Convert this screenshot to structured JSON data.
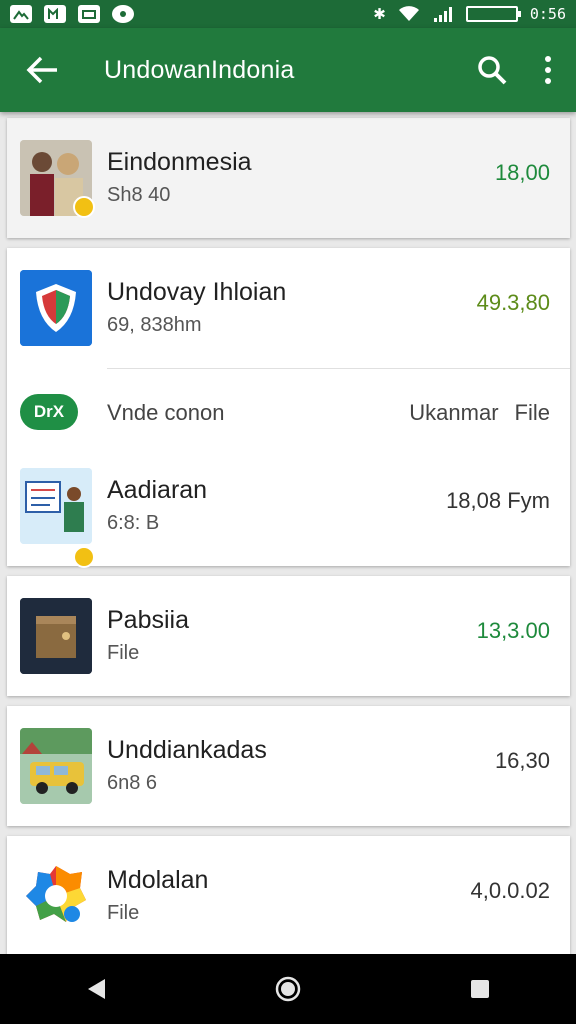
{
  "status_bar": {
    "time": "0:56",
    "left_icons": [
      "image-icon",
      "map-icon",
      "message-icon",
      "camera-icon"
    ],
    "right_icons": [
      "bluetooth-icon",
      "wifi-icon",
      "signal-icon",
      "battery-icon"
    ]
  },
  "app_bar": {
    "title": "UndowanIndonia",
    "back_icon": "arrow-left-icon",
    "search_icon": "search-icon",
    "menu_icon": "more-vert-icon"
  },
  "items": [
    {
      "name": "Eindonmesia",
      "subtitle": "Sh8 40",
      "amount": "18,00",
      "amount_color": "green",
      "thumb": "people-photo"
    },
    {
      "name": "Undovay Ihloian",
      "subtitle": "69, 838hm",
      "amount": "49.3,80",
      "amount_color": "olive",
      "thumb": "shield-app"
    },
    {
      "name": "Aadiaran",
      "subtitle": "6:8: B",
      "amount": "18,08 Fym",
      "amount_color": "default",
      "thumb": "presentation"
    },
    {
      "name": "Pabsiia",
      "subtitle": "File",
      "amount": "13,3.00",
      "amount_color": "green",
      "thumb": "box"
    },
    {
      "name": "Unddiankadas",
      "subtitle": "6n8 6",
      "amount": "16,30",
      "amount_color": "default",
      "thumb": "car-photo"
    },
    {
      "name": "Mdolalan",
      "subtitle": "File",
      "amount": "4,0.0.02",
      "amount_color": "default",
      "thumb": "colorful-logo"
    }
  ],
  "tag_row": {
    "tag": "DrX",
    "label": "Vnde conon",
    "right_label": "Ukanmar",
    "right_file": "File"
  },
  "colors": {
    "primary": "#217a3d",
    "status_bar": "#1d6b37",
    "amount_green": "#1e8a3c",
    "amount_olive": "#5d8c1a"
  },
  "nav_bar": {
    "back": "back-triangle-icon",
    "home": "home-circle-icon",
    "recents": "recents-square-icon"
  }
}
